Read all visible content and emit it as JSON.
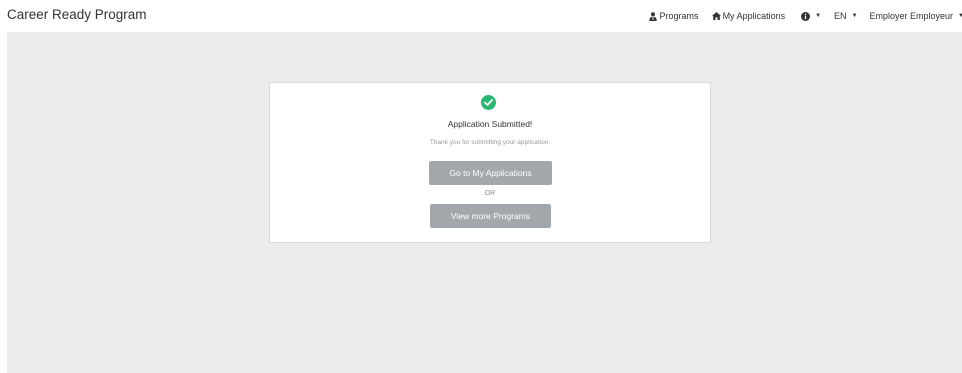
{
  "header": {
    "brand": "Career Ready Program",
    "nav": {
      "programs_label": "Programs",
      "applications_label": "My Applications",
      "language_label": "EN",
      "user_label": "Employer Employeur"
    }
  },
  "confirmation": {
    "title": "Application Submitted!",
    "message": "Thank you for submitting your application.",
    "primary_button": "Go to My Applications",
    "separator": "OR",
    "secondary_button": "View more Programs"
  },
  "icons": {
    "programs": "user-tie-icon",
    "applications": "home-icon",
    "help": "info-circle-icon",
    "success": "check-circle-icon"
  },
  "colors": {
    "background": "#ececec",
    "success": "#2bb673",
    "button": "#a3a8ac"
  }
}
